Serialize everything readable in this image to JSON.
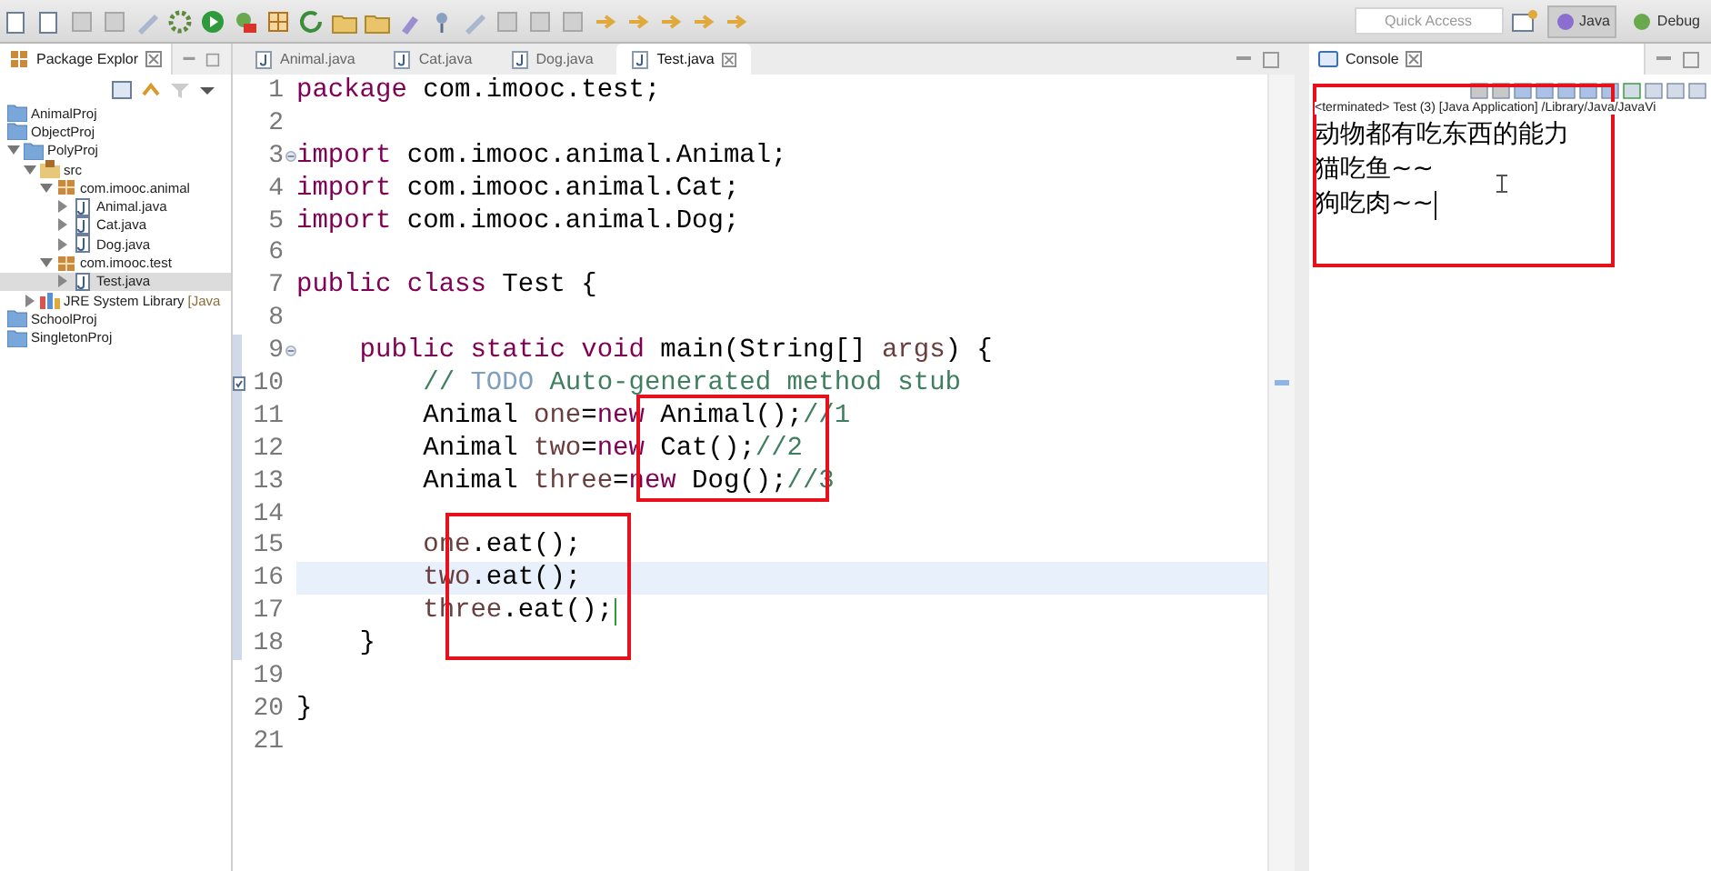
{
  "toolbar": {
    "quick_access": {
      "placeholder": "Quick Access"
    },
    "perspectives": [
      {
        "label": "Java",
        "selected": true
      },
      {
        "label": "Debug",
        "selected": false
      }
    ]
  },
  "package_explorer": {
    "title": "Package Explor",
    "tree": [
      {
        "label": "AnimalProj",
        "kind": "closed-project",
        "selected": false
      },
      {
        "label": "ObjectProj",
        "kind": "closed-project",
        "selected": false
      },
      {
        "label": "PolyProj",
        "kind": "project",
        "expanded": true,
        "selected": false,
        "children": [
          {
            "label": "src",
            "kind": "src",
            "expanded": true,
            "selected": false,
            "children": [
              {
                "label": "com.imooc.animal",
                "kind": "package",
                "expanded": true,
                "selected": false,
                "children": [
                  {
                    "label": "Animal.java",
                    "kind": "java",
                    "expanded": false,
                    "selected": false
                  },
                  {
                    "label": "Cat.java",
                    "kind": "java",
                    "expanded": false,
                    "selected": false
                  },
                  {
                    "label": "Dog.java",
                    "kind": "java",
                    "expanded": false,
                    "selected": false
                  }
                ]
              },
              {
                "label": "com.imooc.test",
                "kind": "package",
                "expanded": true,
                "selected": false,
                "children": [
                  {
                    "label": "Test.java",
                    "kind": "java",
                    "expanded": false,
                    "selected": true
                  }
                ]
              }
            ]
          },
          {
            "label": "JRE System Library",
            "suffix": "[Java",
            "kind": "library",
            "expanded": false,
            "selected": false
          }
        ]
      },
      {
        "label": "SchoolProj",
        "kind": "closed-project",
        "selected": false
      },
      {
        "label": "SingletonProj",
        "kind": "closed-project",
        "selected": false
      }
    ]
  },
  "editor": {
    "tabs": [
      {
        "label": "Animal.java",
        "selected": false
      },
      {
        "label": "Cat.java",
        "selected": false
      },
      {
        "label": "Dog.java",
        "selected": false
      },
      {
        "label": "Test.java",
        "selected": true
      }
    ],
    "lines": [
      {
        "number": "1",
        "current": false,
        "tokens": [
          {
            "kind": "kw",
            "t": "package"
          },
          {
            "kind": "plain",
            "t": " com.imooc.test;"
          }
        ]
      },
      {
        "number": "2",
        "current": false
      },
      {
        "number": "3",
        "current": false,
        "gutter_icon": {
          "kind": "fold"
        },
        "tokens": [
          {
            "kind": "kw",
            "t": "import"
          },
          {
            "kind": "plain",
            "t": " com.imooc.animal.Animal;"
          }
        ]
      },
      {
        "number": "4",
        "current": false,
        "tokens": [
          {
            "kind": "kw",
            "t": "import"
          },
          {
            "kind": "plain",
            "t": " com.imooc.animal.Cat;"
          }
        ]
      },
      {
        "number": "5",
        "current": false,
        "tokens": [
          {
            "kind": "kw",
            "t": "import"
          },
          {
            "kind": "plain",
            "t": " com.imooc.animal.Dog;"
          }
        ]
      },
      {
        "number": "6",
        "current": false
      },
      {
        "number": "7",
        "current": false,
        "tokens": [
          {
            "kind": "kw",
            "t": "public class"
          },
          {
            "kind": "plain",
            "t": " Test {"
          }
        ]
      },
      {
        "number": "8",
        "current": false
      },
      {
        "number": "9",
        "current": false,
        "gutter_icon": {
          "kind": "fold"
        },
        "tokens": [
          {
            "kind": "kw",
            "t": "    public static void"
          },
          {
            "kind": "plain",
            "t": " main(String[] "
          },
          {
            "kind": "var",
            "t": "args"
          },
          {
            "kind": "plain",
            "t": ") {"
          }
        ]
      },
      {
        "number": "10",
        "current": false,
        "gutter_icon": {
          "kind": "task"
        },
        "tokens": [
          {
            "kind": "comment",
            "t": "        // "
          },
          {
            "kind": "todo",
            "t": "TODO"
          },
          {
            "kind": "comment",
            "t": " Auto-generated method stub"
          }
        ]
      },
      {
        "number": "11",
        "current": false,
        "tokens": [
          {
            "kind": "plain",
            "t": "        Animal "
          },
          {
            "kind": "var",
            "t": "one"
          },
          {
            "kind": "plain",
            "t": "="
          },
          {
            "kind": "kw",
            "t": "new"
          },
          {
            "kind": "plain",
            "t": " Animal();"
          },
          {
            "kind": "comment",
            "t": "//1"
          }
        ]
      },
      {
        "number": "12",
        "current": false,
        "tokens": [
          {
            "kind": "plain",
            "t": "        Animal "
          },
          {
            "kind": "var",
            "t": "two"
          },
          {
            "kind": "plain",
            "t": "="
          },
          {
            "kind": "kw",
            "t": "new"
          },
          {
            "kind": "plain",
            "t": " Cat();"
          },
          {
            "kind": "comment",
            "t": "//2"
          }
        ]
      },
      {
        "number": "13",
        "current": false,
        "tokens": [
          {
            "kind": "plain",
            "t": "        Animal "
          },
          {
            "kind": "var",
            "t": "three"
          },
          {
            "kind": "plain",
            "t": "="
          },
          {
            "kind": "kw",
            "t": "new"
          },
          {
            "kind": "plain",
            "t": " Dog();"
          },
          {
            "kind": "comment",
            "t": "//3"
          }
        ]
      },
      {
        "number": "14",
        "current": false
      },
      {
        "number": "15",
        "current": false,
        "tokens": [
          {
            "kind": "var",
            "t": "        one"
          },
          {
            "kind": "plain",
            "t": ".eat();"
          }
        ]
      },
      {
        "number": "16",
        "current": true,
        "tokens": [
          {
            "kind": "var",
            "t": "        two"
          },
          {
            "kind": "plain",
            "t": ".eat();"
          }
        ]
      },
      {
        "number": "17",
        "current": false,
        "caret": true,
        "tokens": [
          {
            "kind": "var",
            "t": "        three"
          },
          {
            "kind": "plain",
            "t": ".eat();"
          }
        ]
      },
      {
        "number": "18",
        "current": false,
        "tokens": [
          {
            "kind": "plain",
            "t": "    }"
          }
        ]
      },
      {
        "number": "19",
        "current": false
      },
      {
        "number": "20",
        "current": false,
        "tokens": [
          {
            "kind": "plain",
            "t": "}"
          }
        ]
      },
      {
        "number": "21",
        "current": false
      }
    ]
  },
  "console": {
    "title": "Console",
    "status": "<terminated> Test (3) [Java Application] /Library/Java/JavaVi",
    "output": [
      "动物都有吃东西的能力",
      "猫吃鱼~~",
      "狗吃肉~~"
    ]
  }
}
